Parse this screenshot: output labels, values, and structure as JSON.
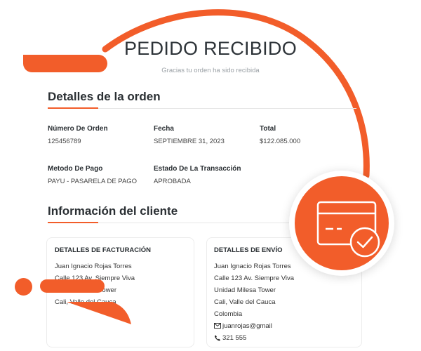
{
  "header": {
    "title": "PEDIDO RECIBIDO",
    "subtitle": "Gracias tu orden ha sido recibida"
  },
  "order": {
    "section_title": "Detalles de la orden",
    "fields": [
      {
        "label": "Número De Orden",
        "value": "125456789"
      },
      {
        "label": "Fecha",
        "value": "SEPTIEMBRE 31, 2023"
      },
      {
        "label": "Total",
        "value": "$122.085.000"
      },
      {
        "label": "Metodo De Pago",
        "value": "PAYU - PASARELA DE PAGO"
      },
      {
        "label": "Estado De La Transacción",
        "value": "APROBADA"
      }
    ]
  },
  "client": {
    "section_title": "Información del cliente",
    "billing": {
      "title": "DETALLES DE FACTURACIÓN",
      "lines": [
        "Juan Ignacio Rojas Torres",
        "Calle 123 Av. Siempre Viva",
        "Unidad Milesa Tower",
        "Cali, Valle del Cauca"
      ]
    },
    "shipping": {
      "title": "DETALLES DE ENVÍO",
      "lines": [
        "Juan Ignacio Rojas Torres",
        "Calle 123 Av. Siempre Viva",
        "Unidad Milesa Tower",
        "Cali, Valle del Cauca",
        "Colombia"
      ],
      "email": "juanrojas@gmail",
      "phone": "321 555"
    }
  },
  "colors": {
    "accent": "#f25d2a",
    "text": "#2a2f33",
    "muted": "#9aa0a5"
  },
  "icons": {
    "badge": "credit-card-check-icon",
    "email": "envelope-icon",
    "phone": "phone-icon"
  }
}
